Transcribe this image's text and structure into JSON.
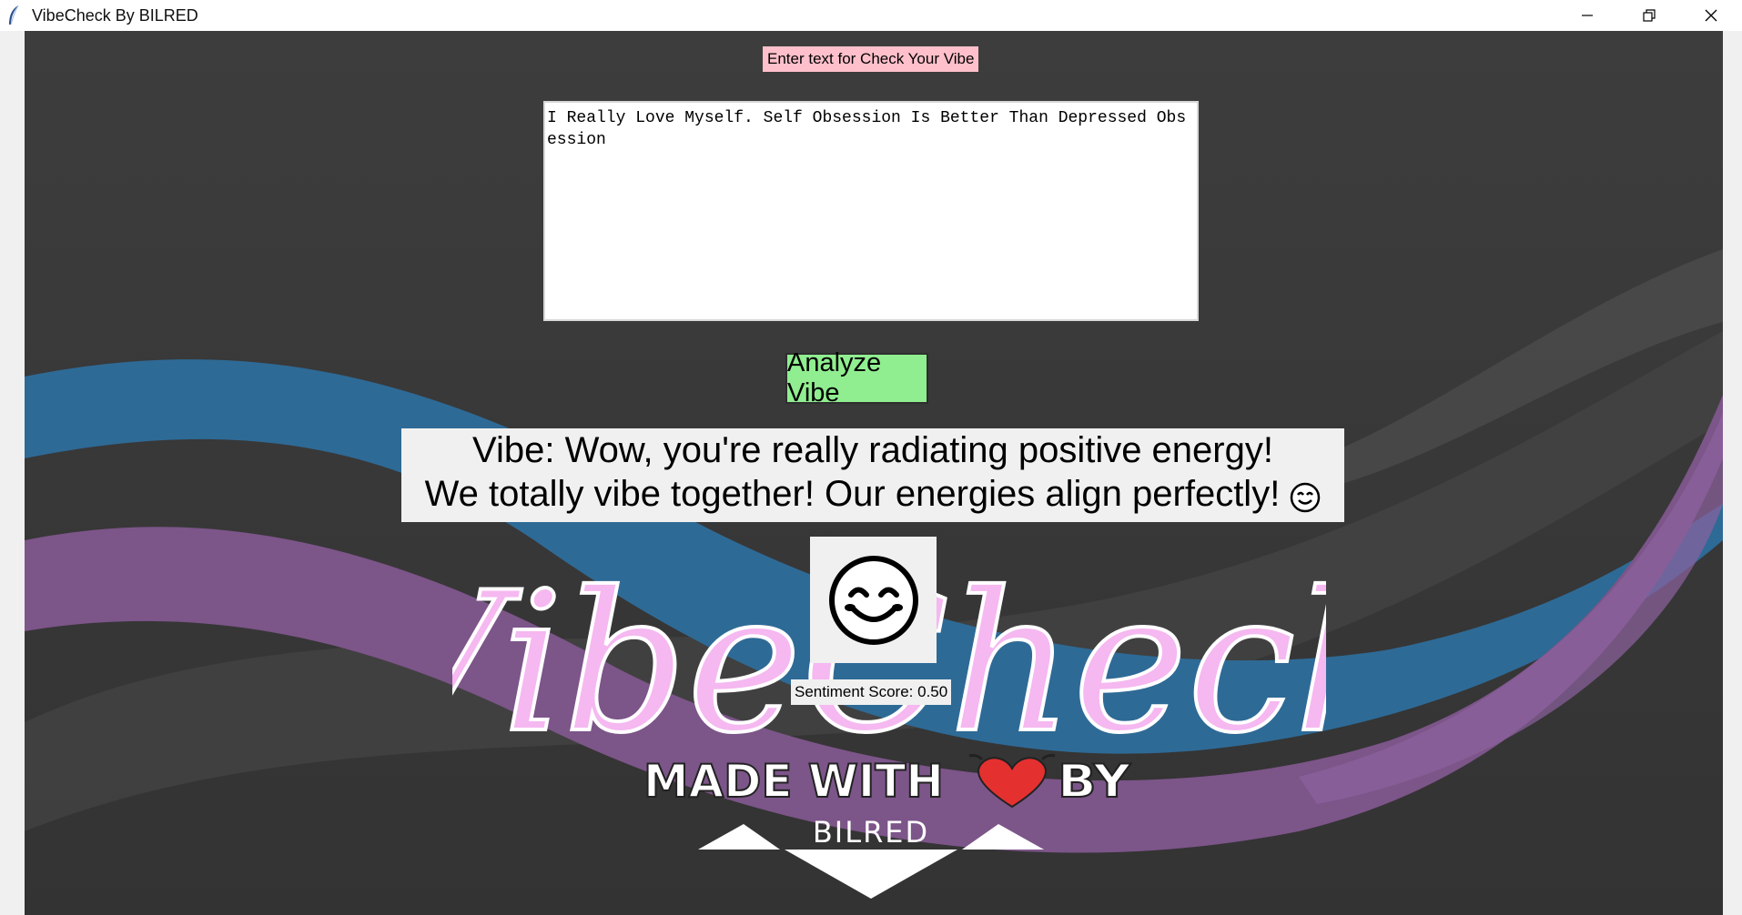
{
  "window": {
    "title": "VibeCheck By BILRED",
    "app_icon": "feather-icon",
    "controls": [
      "minimize-icon",
      "restore-icon",
      "close-icon"
    ]
  },
  "prompt": {
    "label": "Enter text for Check Your Vibe"
  },
  "input": {
    "value": "I Really Love Myself. Self Obsession Is Better Than Depressed Obsession"
  },
  "analyze_button": {
    "label": "Analyze Vibe"
  },
  "result": {
    "line1": "Vibe: Wow, you're really radiating positive energy!",
    "line2": "We totally vibe together! Our energies align perfectly!",
    "emoji": "😊"
  },
  "emoji_display": {
    "icon": "smiling-face-icon"
  },
  "sentiment": {
    "label": "Sentiment Score: 0.50"
  },
  "branding": {
    "logo_text": "VibeCheck",
    "made_with_left": "MADE WITH",
    "made_with_right": "BY",
    "author": "BILRED",
    "heart_icon": "heart-icon"
  },
  "colors": {
    "label_bg": "#ffc0cb",
    "button_bg": "#90ee90",
    "logo_pink": "#f5b8f0",
    "wave_blue": "#2e6a96",
    "wave_purple": "#7c5589",
    "background": "#3a3a3a"
  }
}
